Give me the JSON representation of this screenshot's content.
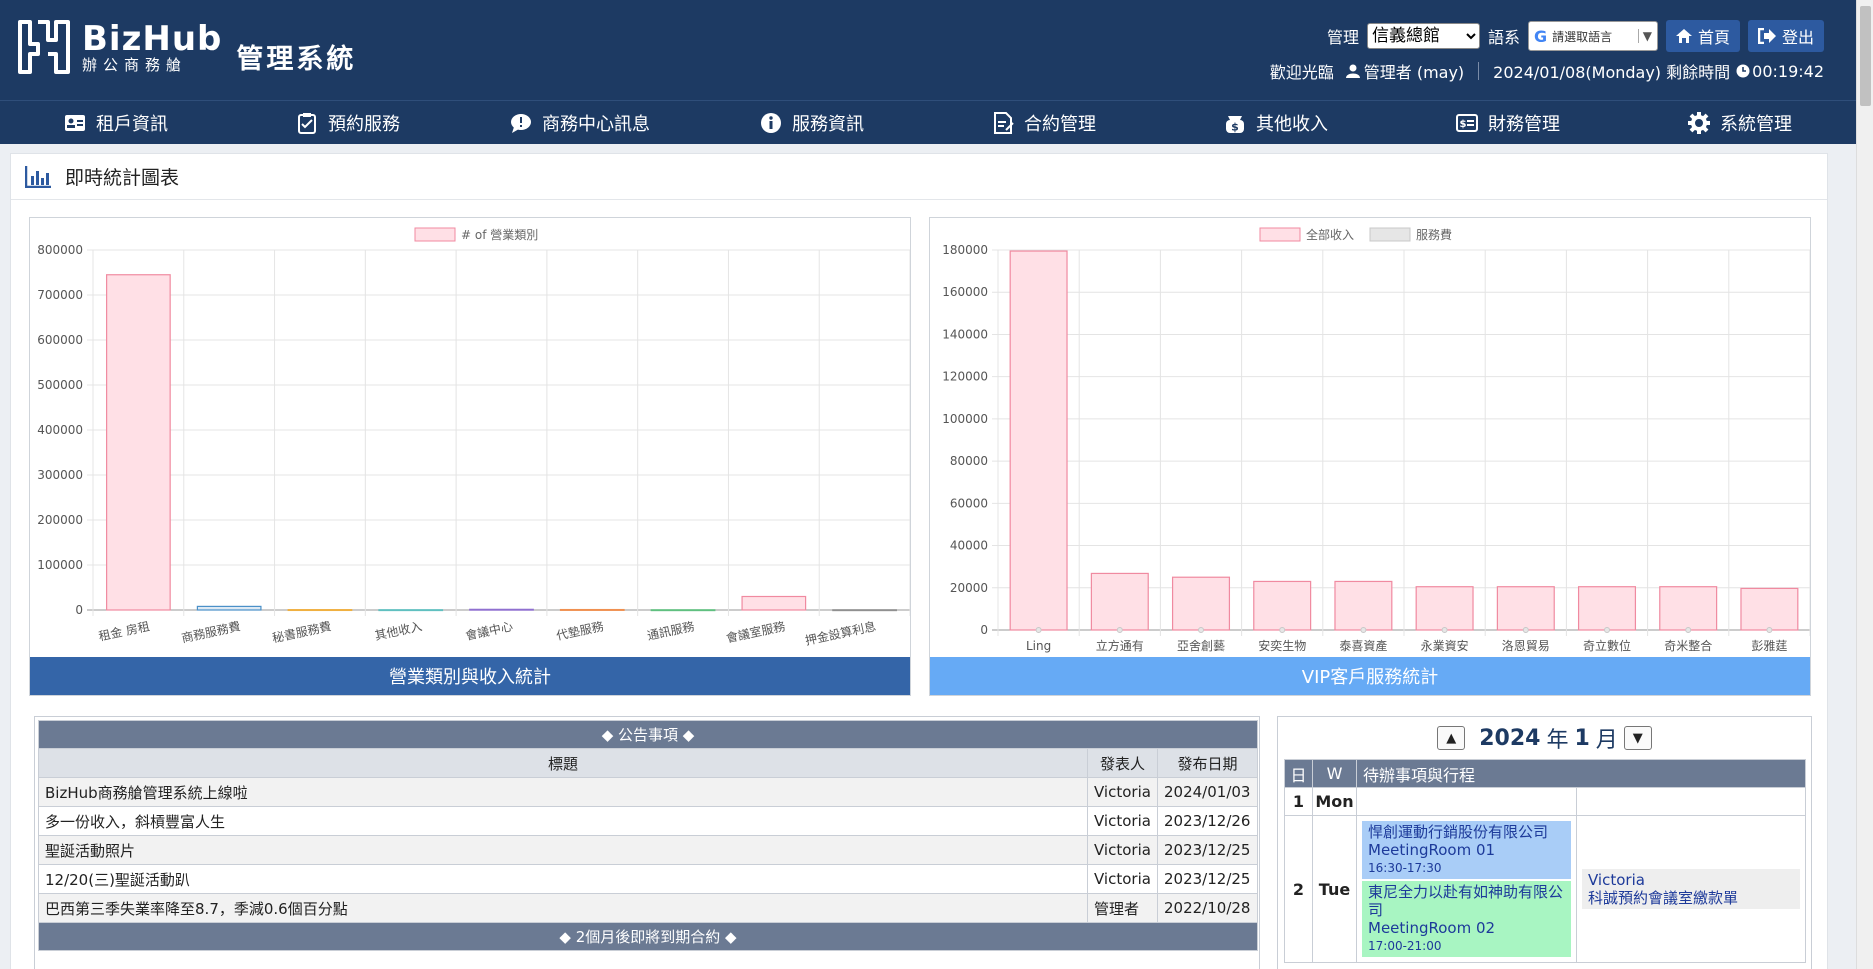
{
  "brand": {
    "name": "BizHub",
    "sub": "辦公商務艙",
    "system": "管理系統"
  },
  "header": {
    "manage_label": "管理",
    "branch_selected": "信義總館",
    "lang_label": "語系",
    "translate_text": "請選取語言",
    "home_label": "首頁",
    "logout_label": "登出",
    "welcome": "歡迎光臨",
    "user": "管理者 (may)",
    "datetime": "2024/01/08(Monday) 剩餘時間",
    "remaining": "00:19:42"
  },
  "nav": [
    {
      "label": "租戶資訊",
      "icon": "id-card-icon"
    },
    {
      "label": "預約服務",
      "icon": "clipboard-icon"
    },
    {
      "label": "商務中心訊息",
      "icon": "chat-icon"
    },
    {
      "label": "服務資訊",
      "icon": "info-icon"
    },
    {
      "label": "合約管理",
      "icon": "contract-icon"
    },
    {
      "label": "其他收入",
      "icon": "money-icon"
    },
    {
      "label": "財務管理",
      "icon": "finance-icon"
    },
    {
      "label": "系統管理",
      "icon": "gear-icon"
    }
  ],
  "page_title": "即時統計圖表",
  "chart_data": [
    {
      "type": "bar",
      "legend": [
        "# of 營業類別"
      ],
      "categories": [
        "租金 房租",
        "商務服務費",
        "秘書服務費",
        "其他收入",
        "會議中心",
        "代墊服務",
        "通訊服務",
        "會議室服務",
        "押金設算利息"
      ],
      "values": [
        745000,
        8000,
        800,
        600,
        1500,
        1000,
        500,
        30000,
        500
      ],
      "ylim": [
        0,
        800000
      ],
      "yticks": [
        "800000",
        "700000",
        "600000",
        "500000",
        "400000",
        "300000",
        "200000",
        "100000",
        "0"
      ],
      "footer": "營業類別與收入統計",
      "colors": {
        "fill": "#ffe0e6",
        "stroke": "#f08aa0",
        "footer": "#3465a8"
      }
    },
    {
      "type": "bar",
      "legend": [
        "全部收入",
        "服務費"
      ],
      "categories": [
        "Ling",
        "立方通有",
        "亞舍創藝",
        "安奕生物",
        "泰喜資產",
        "永業資安",
        "洛恩貿易",
        "奇立數位",
        "奇米整合",
        "彭雅莛"
      ],
      "series": [
        {
          "name": "全部收入",
          "values": [
            179500,
            26800,
            25000,
            23000,
            23000,
            20500,
            20500,
            20500,
            20500,
            19700
          ]
        },
        {
          "name": "服務費",
          "values": [
            0,
            0,
            0,
            0,
            0,
            0,
            0,
            0,
            0,
            0
          ]
        }
      ],
      "ylim": [
        0,
        180000
      ],
      "yticks": [
        "180000",
        "160000",
        "140000",
        "120000",
        "100000",
        "80000",
        "60000",
        "40000",
        "20000",
        "0"
      ],
      "footer": "VIP客戶服務統計",
      "colors": {
        "fill": "#ffe0e6",
        "stroke": "#f08aa0",
        "fill2": "#e6e6e6",
        "footer": "#66aaf5"
      }
    }
  ],
  "announcements": {
    "caption": "◆ 公告事項 ◆",
    "headers": [
      "標題",
      "發表人",
      "發布日期"
    ],
    "rows": [
      [
        "BizHub商務艙管理系統上線啦",
        "Victoria",
        "2024/01/03"
      ],
      [
        "多一份收入，斜槓豐富人生",
        "Victoria",
        "2023/12/26"
      ],
      [
        "聖誕活動照片",
        "Victoria",
        "2023/12/25"
      ],
      [
        "12/20(三)聖誕活動趴",
        "Victoria",
        "2023/12/25"
      ],
      [
        "巴西第三季失業率降至8.7，季減0.6個百分點",
        "管理者",
        "2022/10/28"
      ]
    ],
    "contracts_caption": "◆ 2個月後即將到期合約 ◆"
  },
  "calendar": {
    "year": "2024",
    "year_unit": "年",
    "month": "1",
    "month_unit": "月",
    "up": "▲",
    "down": "▼",
    "headers": [
      "日",
      "W",
      "待辦事項與行程"
    ],
    "days": [
      {
        "day": "1",
        "weekday": "Mon"
      },
      {
        "day": "2",
        "weekday": "Tue"
      }
    ],
    "events": [
      {
        "company": "悍創運動行銷股份有限公司",
        "room": "MeetingRoom 01",
        "time": "16:30-17:30"
      },
      {
        "company": "東尼全力以赴有如神助有限公司",
        "room": "MeetingRoom 02",
        "time": "17:00-21:00"
      }
    ],
    "todo": {
      "who": "Victoria",
      "text": "科誠預約會議室繳款單"
    }
  }
}
